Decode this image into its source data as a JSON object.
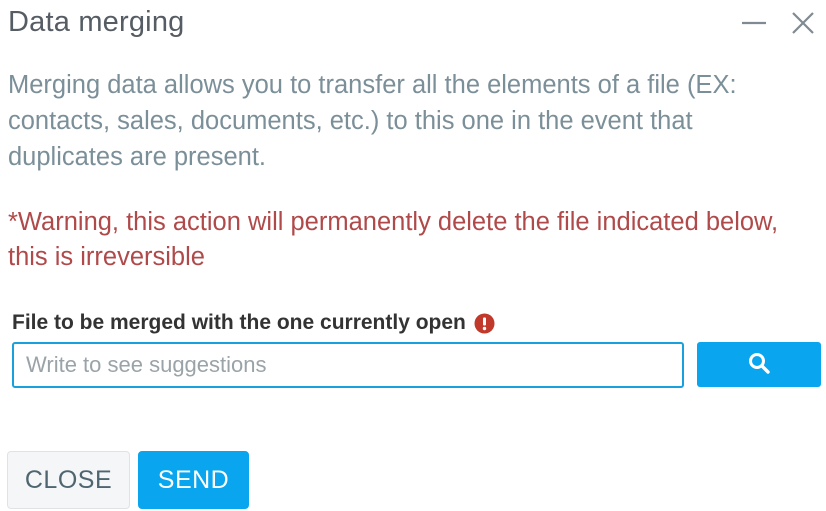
{
  "dialog": {
    "title": "Data merging",
    "description": "Merging data allows you to transfer all the elements of a file (EX: contacts, sales, documents, etc.) to this one in the event that duplicates are present.",
    "warning": "*Warning, this action will permanently delete the file indicated below, this is irreversible"
  },
  "field": {
    "label": "File to be merged with the one currently open",
    "label_icon": "exclamation-circle-icon",
    "placeholder": "Write to see suggestions",
    "value": "",
    "search_icon": "search-icon"
  },
  "window_controls": {
    "minimize_icon": "minimize-icon",
    "close_icon": "close-icon"
  },
  "buttons": {
    "close_label": "CLOSE",
    "send_label": "SEND"
  },
  "colors": {
    "accent": "#0aa5ef",
    "warning": "#b04a4a",
    "description": "#7b8f99",
    "title": "#555c63",
    "alert_icon": "#c0392b"
  }
}
